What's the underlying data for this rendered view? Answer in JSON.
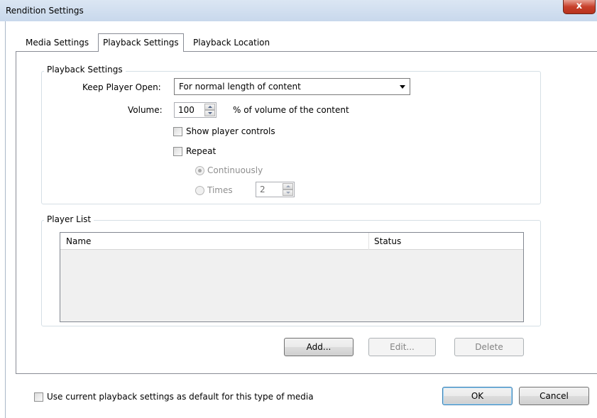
{
  "window": {
    "title": "Rendition Settings",
    "close_label": "x"
  },
  "tabs": [
    {
      "label": "Media Settings",
      "active": false
    },
    {
      "label": "Playback Settings",
      "active": true
    },
    {
      "label": "Playback Location",
      "active": false
    }
  ],
  "playback_settings": {
    "group_label": "Playback Settings",
    "keep_player_open_label": "Keep Player Open:",
    "keep_player_open_value": "For normal length of content",
    "volume_label": "Volume:",
    "volume_value": "100",
    "volume_suffix": "% of  volume of  the content",
    "show_controls_label": "Show player controls",
    "show_controls_checked": false,
    "repeat_label": "Repeat",
    "repeat_checked": false,
    "continuously_label": "Continuously",
    "continuously_selected": true,
    "times_label": "Times",
    "times_value": "2"
  },
  "player_list": {
    "group_label": "Player List",
    "columns": [
      "Name",
      "Status"
    ],
    "rows": []
  },
  "buttons": {
    "add": "Add...",
    "edit": "Edit...",
    "delete": "Delete",
    "ok": "OK",
    "cancel": "Cancel"
  },
  "footer": {
    "default_checkbox_label": "Use current playback settings as default for this type of media",
    "default_checkbox_checked": false
  }
}
